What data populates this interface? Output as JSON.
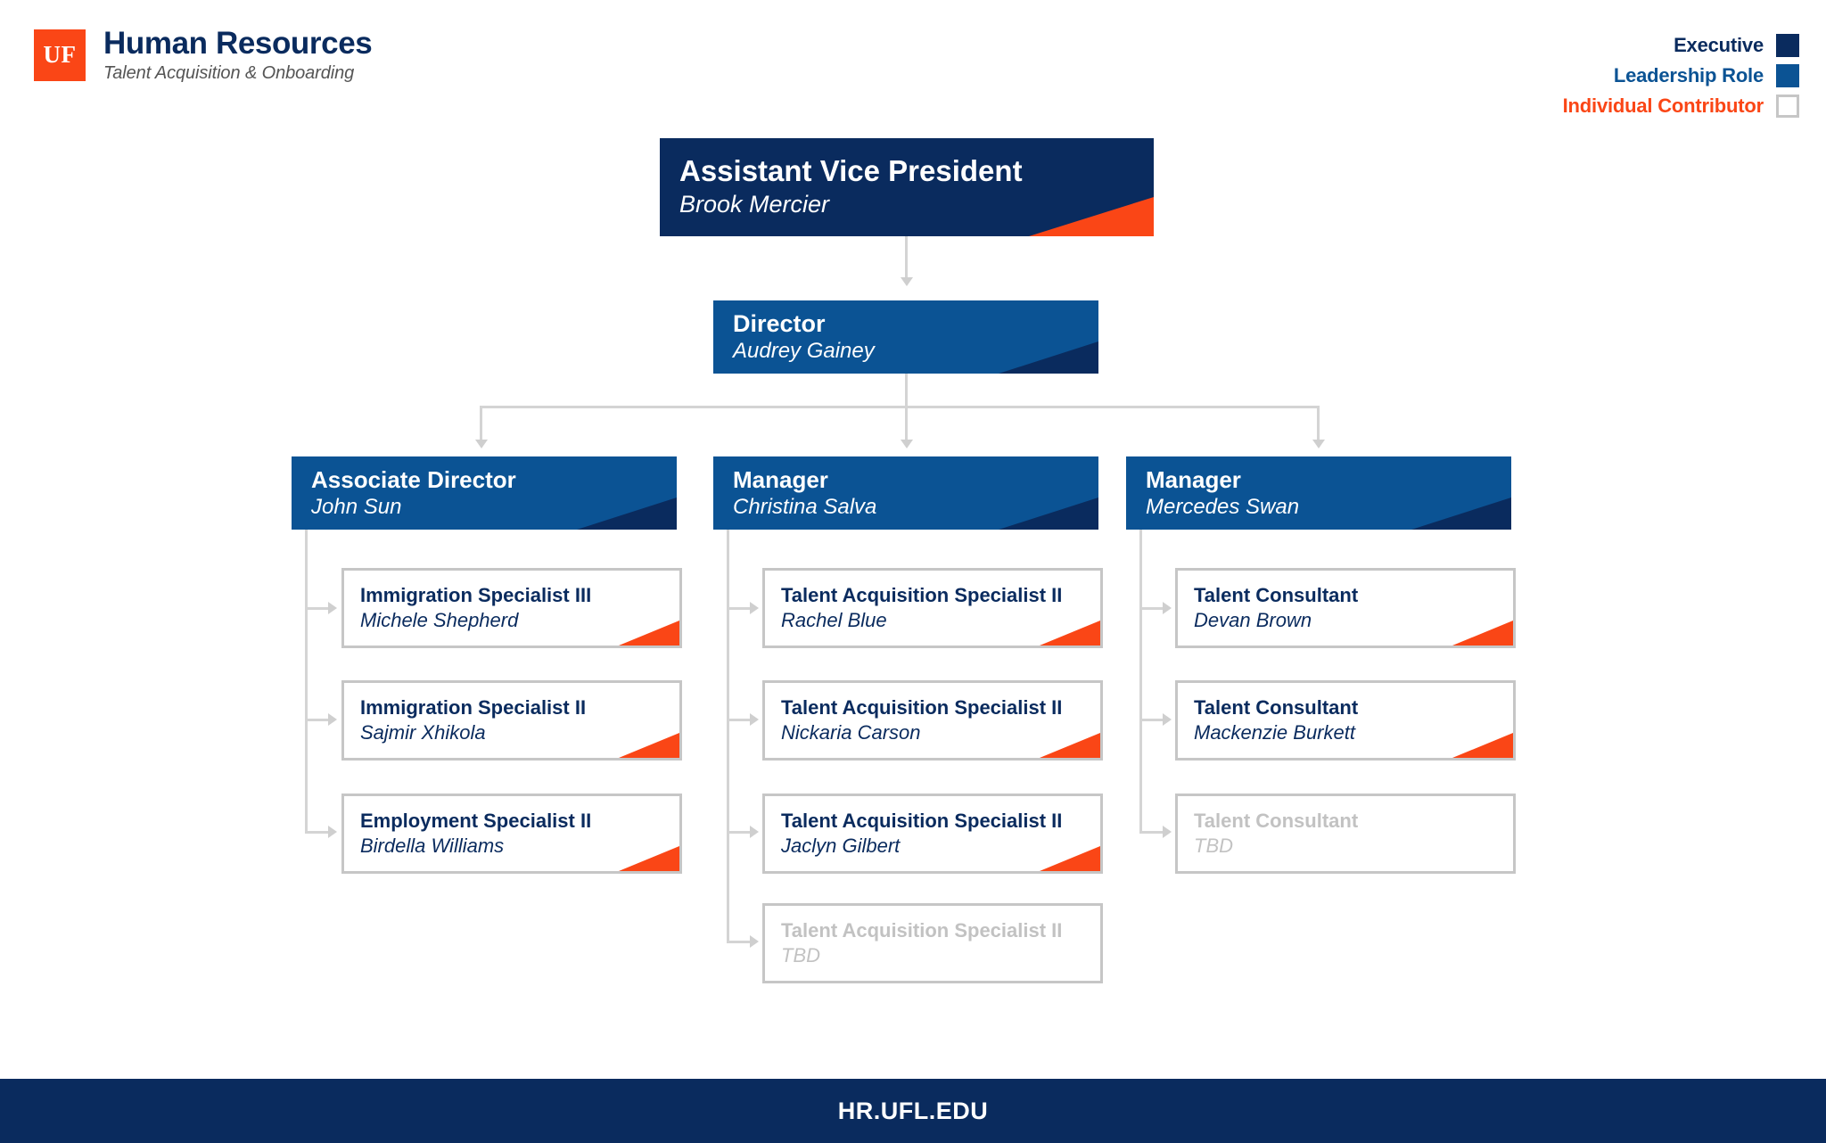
{
  "header": {
    "logo_text": "UF",
    "title": "Human Resources",
    "subtitle": "Talent Acquisition & Onboarding"
  },
  "legend": {
    "items": [
      {
        "label": "Executive",
        "text_color": "#0A2B5E",
        "swatch_color": "#0A2B5E",
        "swatch_border": "#0A2B5E"
      },
      {
        "label": "Leadership Role",
        "text_color": "#0B5394",
        "swatch_color": "#0B5394",
        "swatch_border": "#0B5394"
      },
      {
        "label": "Individual Contributor",
        "text_color": "#FA4616",
        "swatch_color": "#ffffff",
        "swatch_border": "#c6c6c6"
      }
    ]
  },
  "colors": {
    "navy": "#0A2B5E",
    "blue": "#0B5394",
    "orange": "#FA4616",
    "border_gray": "#c6c6c6",
    "connector_gray": "#d4d4d4",
    "vacant_gray": "#c2c2c2"
  },
  "chart_data": {
    "type": "org-chart",
    "title": "Talent Acquisition & Onboarding Organizational Chart",
    "levels": 4,
    "nodes": [
      {
        "id": "avp",
        "title": "Assistant Vice President",
        "name": "Brook Mercier",
        "level": 1,
        "category": "Executive",
        "parent": null,
        "vacant": false
      },
      {
        "id": "dir",
        "title": "Director",
        "name": "Audrey Gainey",
        "level": 2,
        "category": "Leadership Role",
        "parent": "avp",
        "vacant": false
      },
      {
        "id": "assoc-dir",
        "title": "Associate Director",
        "name": "John Sun",
        "level": 3,
        "category": "Leadership Role",
        "parent": "dir",
        "vacant": false
      },
      {
        "id": "mgr-salva",
        "title": "Manager",
        "name": "Christina Salva",
        "level": 3,
        "category": "Leadership Role",
        "parent": "dir",
        "vacant": false
      },
      {
        "id": "mgr-swan",
        "title": "Manager",
        "name": "Mercedes Swan",
        "level": 3,
        "category": "Leadership Role",
        "parent": "dir",
        "vacant": false
      },
      {
        "id": "ic-1-1",
        "title": "Immigration Specialist III",
        "name": "Michele Shepherd",
        "level": 4,
        "category": "Individual Contributor",
        "parent": "assoc-dir",
        "vacant": false
      },
      {
        "id": "ic-1-2",
        "title": "Immigration Specialist II",
        "name": "Sajmir Xhikola",
        "level": 4,
        "category": "Individual Contributor",
        "parent": "assoc-dir",
        "vacant": false
      },
      {
        "id": "ic-1-3",
        "title": "Employment Specialist II",
        "name": "Birdella Williams",
        "level": 4,
        "category": "Individual Contributor",
        "parent": "assoc-dir",
        "vacant": false
      },
      {
        "id": "ic-2-1",
        "title": "Talent Acquisition Specialist II",
        "name": "Rachel Blue",
        "level": 4,
        "category": "Individual Contributor",
        "parent": "mgr-salva",
        "vacant": false
      },
      {
        "id": "ic-2-2",
        "title": "Talent Acquisition Specialist II",
        "name": "Nickaria Carson",
        "level": 4,
        "category": "Individual Contributor",
        "parent": "mgr-salva",
        "vacant": false
      },
      {
        "id": "ic-2-3",
        "title": "Talent Acquisition Specialist II",
        "name": "Jaclyn Gilbert",
        "level": 4,
        "category": "Individual Contributor",
        "parent": "mgr-salva",
        "vacant": false
      },
      {
        "id": "ic-2-4",
        "title": "Talent Acquisition Specialist II",
        "name": "TBD",
        "level": 4,
        "category": "Individual Contributor",
        "parent": "mgr-salva",
        "vacant": true
      },
      {
        "id": "ic-3-1",
        "title": "Talent Consultant",
        "name": "Devan Brown",
        "level": 4,
        "category": "Individual Contributor",
        "parent": "mgr-swan",
        "vacant": false
      },
      {
        "id": "ic-3-2",
        "title": "Talent Consultant",
        "name": "Mackenzie Burkett",
        "level": 4,
        "category": "Individual Contributor",
        "parent": "mgr-swan",
        "vacant": false
      },
      {
        "id": "ic-3-3",
        "title": "Talent Consultant",
        "name": "TBD",
        "level": 4,
        "category": "Individual Contributor",
        "parent": "mgr-swan",
        "vacant": true
      }
    ]
  },
  "org": {
    "avp": {
      "title": "Assistant Vice President",
      "name": "Brook Mercier"
    },
    "director": {
      "title": "Director",
      "name": "Audrey Gainey"
    },
    "assoc_dir": {
      "title": "Associate Director",
      "name": "John Sun"
    },
    "mgr_salva": {
      "title": "Manager",
      "name": "Christina Salva"
    },
    "mgr_swan": {
      "title": "Manager",
      "name": "Mercedes Swan"
    },
    "col1": [
      {
        "title": "Immigration Specialist III",
        "name": "Michele Shepherd"
      },
      {
        "title": "Immigration Specialist II",
        "name": "Sajmir Xhikola"
      },
      {
        "title": "Employment Specialist II",
        "name": "Birdella Williams"
      }
    ],
    "col2": [
      {
        "title": "Talent Acquisition Specialist II",
        "name": "Rachel Blue"
      },
      {
        "title": "Talent Acquisition Specialist II",
        "name": "Nickaria Carson"
      },
      {
        "title": "Talent Acquisition Specialist II",
        "name": "Jaclyn Gilbert"
      },
      {
        "title": "Talent Acquisition Specialist II",
        "name": "TBD"
      }
    ],
    "col3": [
      {
        "title": "Talent Consultant",
        "name": "Devan Brown"
      },
      {
        "title": "Talent Consultant",
        "name": "Mackenzie Burkett"
      },
      {
        "title": "Talent Consultant",
        "name": "TBD"
      }
    ]
  },
  "footer": {
    "url": "HR.UFL.EDU"
  }
}
